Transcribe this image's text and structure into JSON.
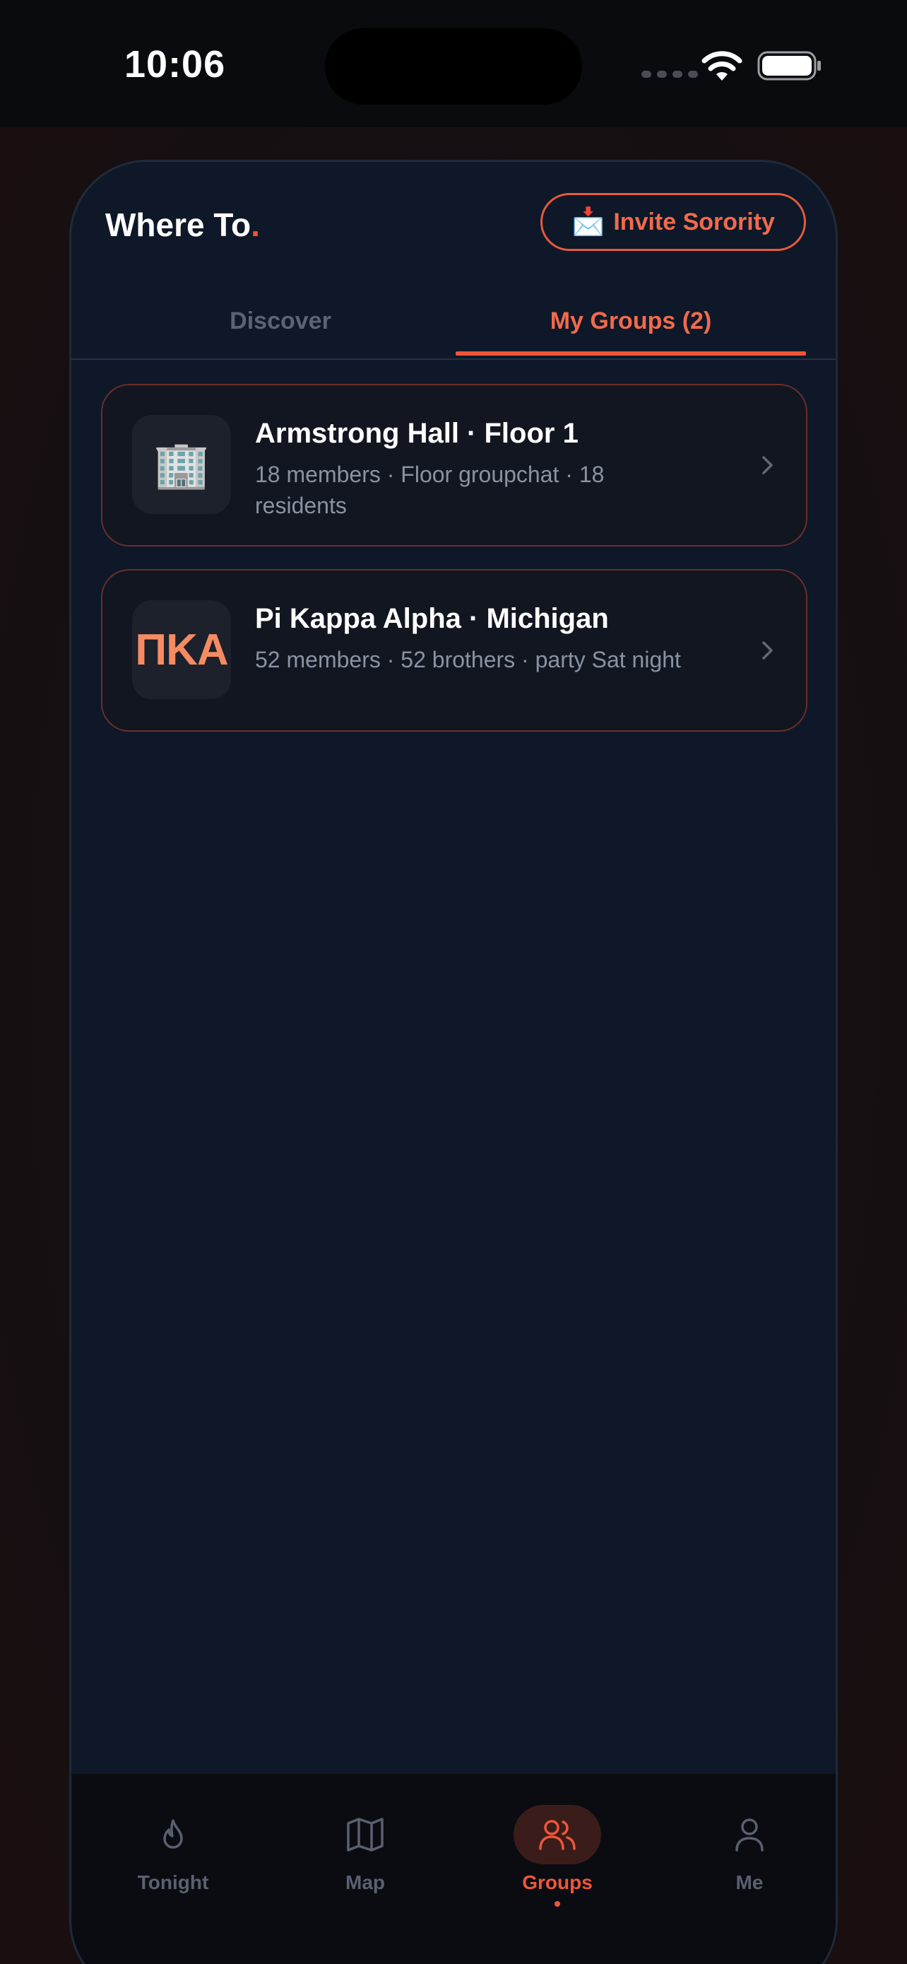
{
  "status_bar": {
    "time": "10:06"
  },
  "header": {
    "title": "Where To",
    "title_dot": ".",
    "invite_button": {
      "icon": "📩",
      "label": "Invite Sorority"
    }
  },
  "tabs": [
    {
      "label": "Discover",
      "active": false
    },
    {
      "label": "My Groups (2)",
      "active": true
    }
  ],
  "groups": [
    {
      "avatar": "🏢",
      "name": "Armstrong Hall · Floor 1",
      "meta": "18 members · Floor groupchat · 18 residents"
    },
    {
      "avatar": "ΠΚΑ",
      "name": "Pi Kappa Alpha · Michigan",
      "meta": "52 members · 52 brothers · party Sat night"
    }
  ],
  "bottom_nav": [
    {
      "label": "Tonight",
      "icon": "flame-icon",
      "active": false
    },
    {
      "label": "Map",
      "icon": "map-icon",
      "active": false
    },
    {
      "label": "Groups",
      "icon": "users-icon",
      "active": true
    },
    {
      "label": "Me",
      "icon": "user-icon",
      "active": false
    }
  ],
  "colors": {
    "accent": "#f0553b",
    "background": "#0e1828",
    "card": "#121620",
    "card_border": "#6b2f2a",
    "muted_text": "#8a93a3"
  }
}
